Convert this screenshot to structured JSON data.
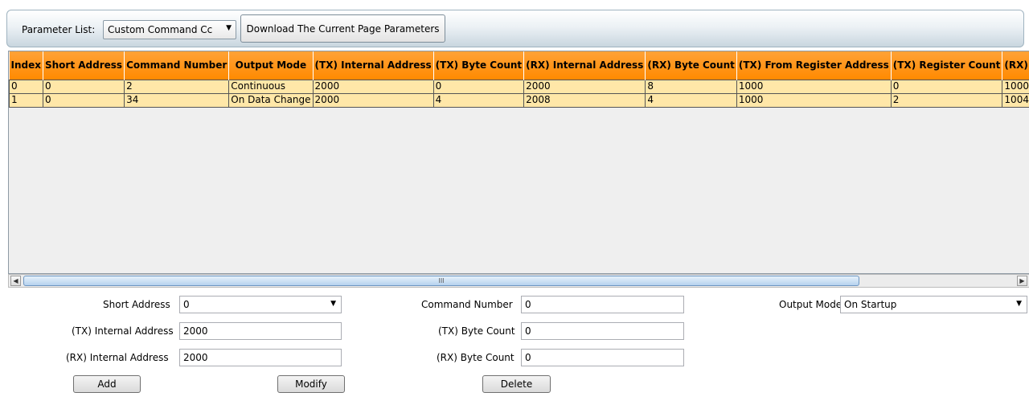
{
  "toolbar": {
    "param_list_label": "Parameter List:",
    "param_list_value": "Custom Command Cc",
    "download_label": "Download The Current Page Parameters"
  },
  "table": {
    "columns": [
      "Index",
      "Short Address",
      "Command Number",
      "Output Mode",
      "(TX) Internal Address",
      "(TX) Byte Count",
      "(RX) Internal  Address",
      "(RX) Byte Count",
      "(TX) From Register Address",
      "(TX) Register Count",
      "(RX) To"
    ],
    "rows": [
      [
        "0",
        "0",
        "2",
        "Continuous",
        "2000",
        "0",
        "2000",
        "8",
        "1000",
        "0",
        "1000"
      ],
      [
        "1",
        "0",
        "34",
        "On Data Change",
        "2000",
        "4",
        "2008",
        "4",
        "1000",
        "2",
        "1004"
      ]
    ]
  },
  "scrollbar": {
    "thumb_grip": "III"
  },
  "form": {
    "short_address_label": "Short Address",
    "short_address_value": "0",
    "command_number_label": "Command Number",
    "command_number_value": "0",
    "output_mode_label": "Output Mode",
    "output_mode_value": "On Startup",
    "tx_internal_label": "(TX) Internal Address",
    "tx_internal_value": "2000",
    "tx_byte_label": "(TX) Byte Count",
    "tx_byte_value": "0",
    "rx_internal_label": "(RX) Internal  Address",
    "rx_internal_value": "2000",
    "rx_byte_label": "(RX) Byte Count",
    "rx_byte_value": "0",
    "add_label": "Add",
    "modify_label": "Modify",
    "delete_label": "Delete"
  },
  "icons": {
    "dropdown": "chevron-down-icon",
    "scroll_left": "arrow-left-icon",
    "scroll_right": "arrow-right-icon"
  }
}
